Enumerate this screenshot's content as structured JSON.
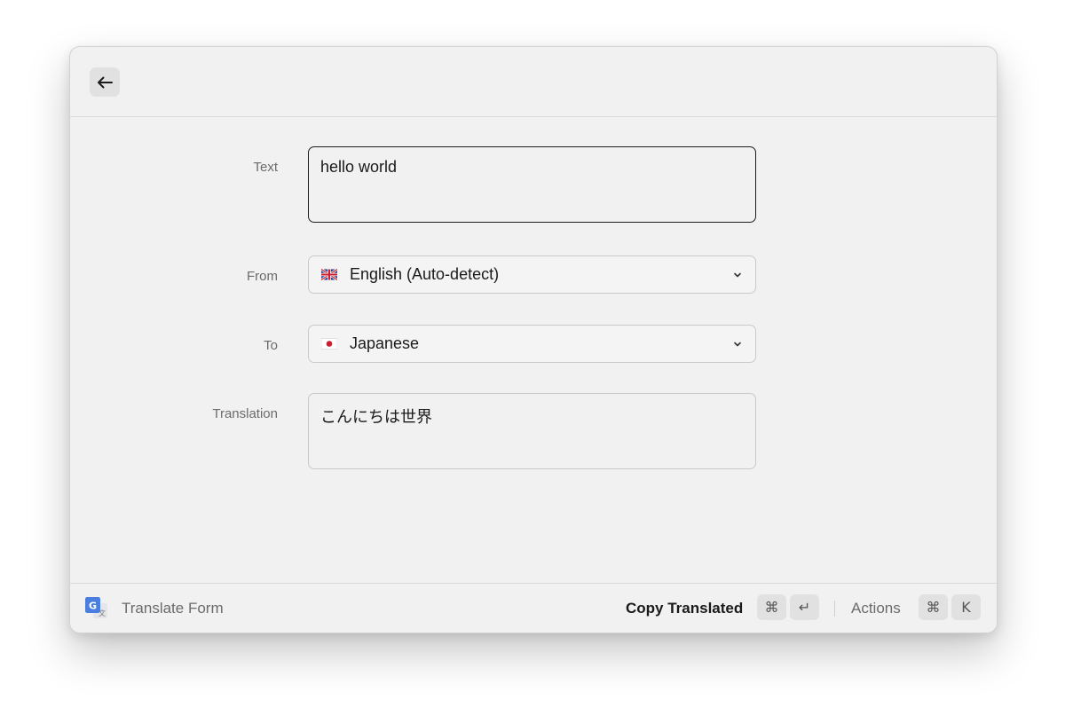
{
  "form": {
    "text": {
      "label": "Text",
      "value": "hello world"
    },
    "from": {
      "label": "From",
      "value": "English (Auto-detect)",
      "flag": "uk-flag-icon"
    },
    "to": {
      "label": "To",
      "value": "Japanese",
      "flag": "japan-flag-icon"
    },
    "translation": {
      "label": "Translation",
      "value": "こんにちは世界"
    }
  },
  "footer": {
    "title": "Translate Form",
    "icon": "google-translate-icon",
    "primary_action": "Copy Translated",
    "primary_shortcut": [
      "⌘",
      "↵"
    ],
    "actions_label": "Actions",
    "actions_shortcut": [
      "⌘",
      "K"
    ]
  },
  "colors": {
    "window_bg": "#f1f1f1",
    "text": "#1a1a1a",
    "muted": "#6b6b6b",
    "kbd_bg": "#e1e1e1",
    "focus_border": "#1c1c1c"
  }
}
